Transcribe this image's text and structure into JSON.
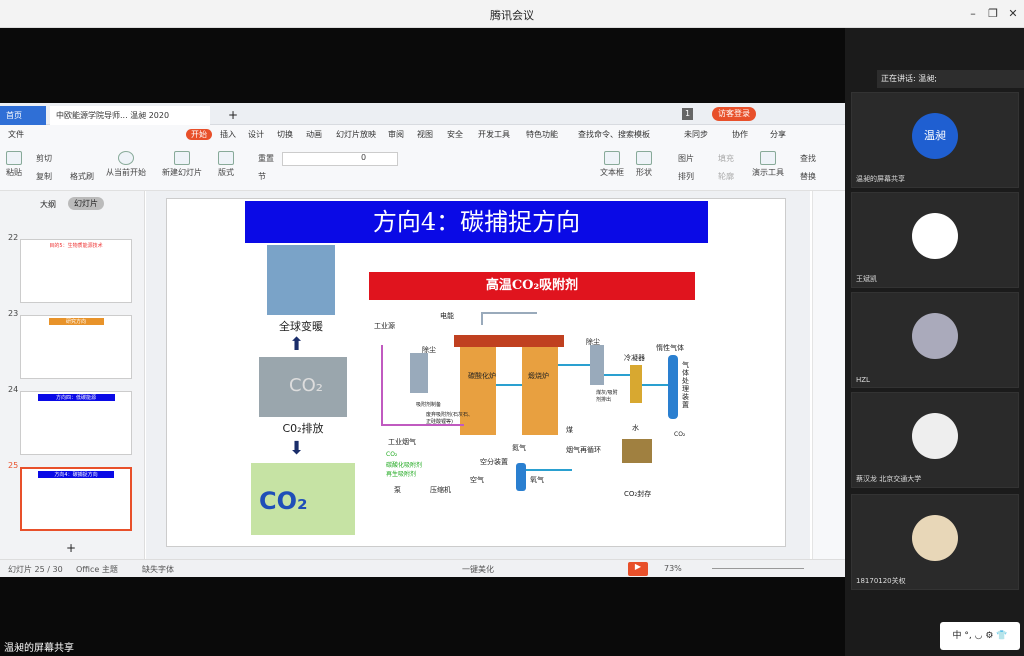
{
  "window": {
    "title": "腾讯会议"
  },
  "wps": {
    "tabs": [
      {
        "label": "首页"
      },
      {
        "label": "中欧能源学院导师... 温昶 2020"
      }
    ],
    "badge": "1",
    "login_label": "访客登录",
    "menus": [
      "文件",
      "开始",
      "插入",
      "设计",
      "切换",
      "动画",
      "幻灯片放映",
      "审阅",
      "视图",
      "安全",
      "开发工具",
      "特色功能"
    ],
    "search_placeholder": "查找命令、搜索模板",
    "sync": "未同步",
    "collab": "协作",
    "share": "分享",
    "ribbon": {
      "paste": "粘贴",
      "cut": "剪切",
      "copy": "复制",
      "format_painter": "格式刷",
      "play_from_current": "从当前开始",
      "new_slide": "新建幻灯片",
      "layout": "版式",
      "section": "节",
      "reset": "重置",
      "font_size": "0",
      "textbox": "文本框",
      "shape": "形状",
      "picture": "图片",
      "arrange": "排列",
      "outline": "轮廓",
      "fill": "填充",
      "present_tools": "演示工具",
      "find": "查找",
      "replace": "替换"
    },
    "pane_tabs": [
      "大纲",
      "幻灯片"
    ],
    "thumbs": [
      {
        "num": "22",
        "title": "目的5：生物质能源技术"
      },
      {
        "num": "23",
        "title": "研究方向"
      },
      {
        "num": "24",
        "title": "方向四：低碳能源"
      },
      {
        "num": "25",
        "title": "方向4：碳捕捉方向"
      }
    ],
    "status": {
      "slide_count": "幻灯片 25 / 30",
      "theme": "Office 主题",
      "missing_font": "缺失字体",
      "beautify": "一键美化",
      "zoom": "73%"
    }
  },
  "slide": {
    "title": "方向4：碳捕捉方向",
    "caption_warming": "全球变暖",
    "caption_emission": "C0₂排放",
    "diagram_title": "高温CO₂吸附剂",
    "labels": {
      "industrial_source": "工业源",
      "power": "电能",
      "dust1": "除尘",
      "carbonation": "碳酸化炉",
      "calcination": "煅烧炉",
      "dust2": "除尘",
      "cooler": "冷凝器",
      "inert": "惰性气体",
      "gas_processing": "气体处理装置",
      "sorbent_prep": "吸附剂制备",
      "waste_sorbent": "废弃吸附剂(石灰石、正硅酸锂等)",
      "coal": "煤",
      "industrial_flue": "工业烟气",
      "co2": "CO₂",
      "carbonated_sorbent": "碳酸化吸附剂",
      "regen_sorbent": "再生吸附剂",
      "pump": "泵",
      "compressor": "压缩机",
      "nitrogen": "氮气",
      "asu": "空分装置",
      "air": "空气",
      "oxygen": "氧气",
      "flue_recycle": "烟气再循环",
      "co2_storage": "CO₂封存",
      "water": "水",
      "dust_out": "煤灰/吸附剂排出",
      "co2_out": "CO₂"
    }
  },
  "meeting": {
    "speaking": "正在讲话: 温昶;",
    "host_avatar_text": "温昶",
    "participants": [
      {
        "name": "温昶的屏幕共享"
      },
      {
        "name": "王斌凯"
      },
      {
        "name": "HZL"
      },
      {
        "name": "蔡汉龙 北京交通大学"
      },
      {
        "name": "18170120关权"
      }
    ],
    "share_label": "温昶的屏幕共享",
    "ime": "中 °, ◡ ⚙ 👕"
  },
  "colors": {
    "title_blue": "#0a0ae6",
    "diagram_red": "#e0141e",
    "wps_orange": "#e8502a",
    "host_blue": "#1f5fd1"
  }
}
